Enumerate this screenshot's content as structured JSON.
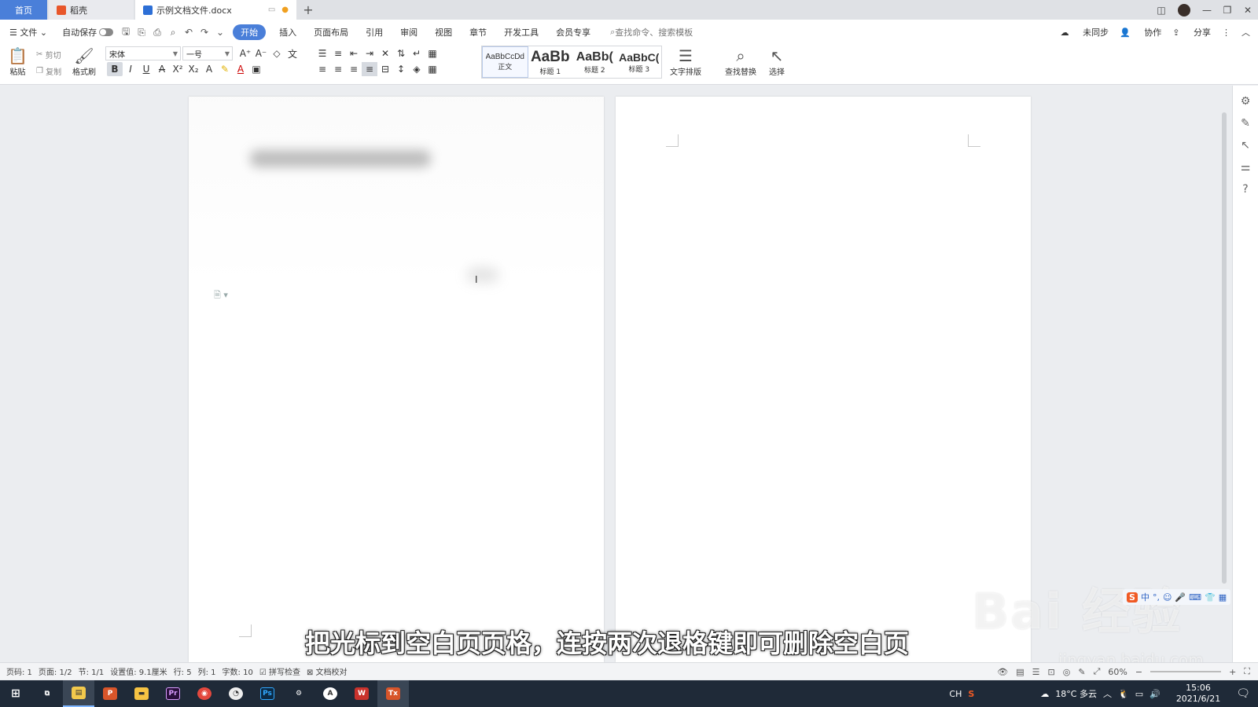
{
  "tabs": {
    "home": "首页",
    "daoke": "稻壳",
    "doc": "示例文档文件.docx",
    "add": "+"
  },
  "window_controls": {
    "layout": "◫",
    "minimize": "—",
    "restore": "❐",
    "close": "✕"
  },
  "menu": {
    "file": "文件",
    "autosave": "自动保存",
    "items": [
      "开始",
      "插入",
      "页面布局",
      "引用",
      "审阅",
      "视图",
      "章节",
      "开发工具",
      "会员专享"
    ],
    "search_placeholder": "查找命令、搜索模板",
    "unsynced": "未同步",
    "collaborate": "协作",
    "share": "分享"
  },
  "ribbon": {
    "paste": "粘贴",
    "cut": "剪切",
    "copy": "复制",
    "format_painter": "格式刷",
    "font_name": "宋体",
    "font_size": "一号",
    "text_layout": "文字排版",
    "find_replace": "查找替换",
    "select": "选择",
    "styles": [
      {
        "preview": "AaBbCcDd",
        "label": "正文"
      },
      {
        "preview": "AaBb",
        "label": "标题 1"
      },
      {
        "preview": "AaBb(",
        "label": "标题 2"
      },
      {
        "preview": "AaBbC(",
        "label": "标题 3"
      }
    ]
  },
  "subtitle": "把光标到空白页页格，连按两次退格键即可删除空白页",
  "watermark": {
    "brand": "Bai 经验",
    "url": "jingyan.baidu.com"
  },
  "ime": {
    "mode": "中",
    "punct": "°,"
  },
  "status": {
    "page_num": "页码: 1",
    "pages": "页面: 1/2",
    "section": "节: 1/1",
    "setting": "设置值: 9.1厘米",
    "row": "行: 5",
    "col": "列: 1",
    "word_count": "字数: 10",
    "spell_check": "拼写检查",
    "doc_proof": "文档校对",
    "zoom": "60%"
  },
  "taskbar": {
    "apps": [
      "start",
      "task-view",
      "files",
      "slides",
      "explorer",
      "premiere",
      "chrome",
      "speed",
      "photoshop",
      "settings",
      "apowersoft",
      "wps",
      "wps-writer"
    ],
    "lang": "CH",
    "weather": "18°C 多云",
    "time": "15:06",
    "date": "2021/6/21"
  }
}
